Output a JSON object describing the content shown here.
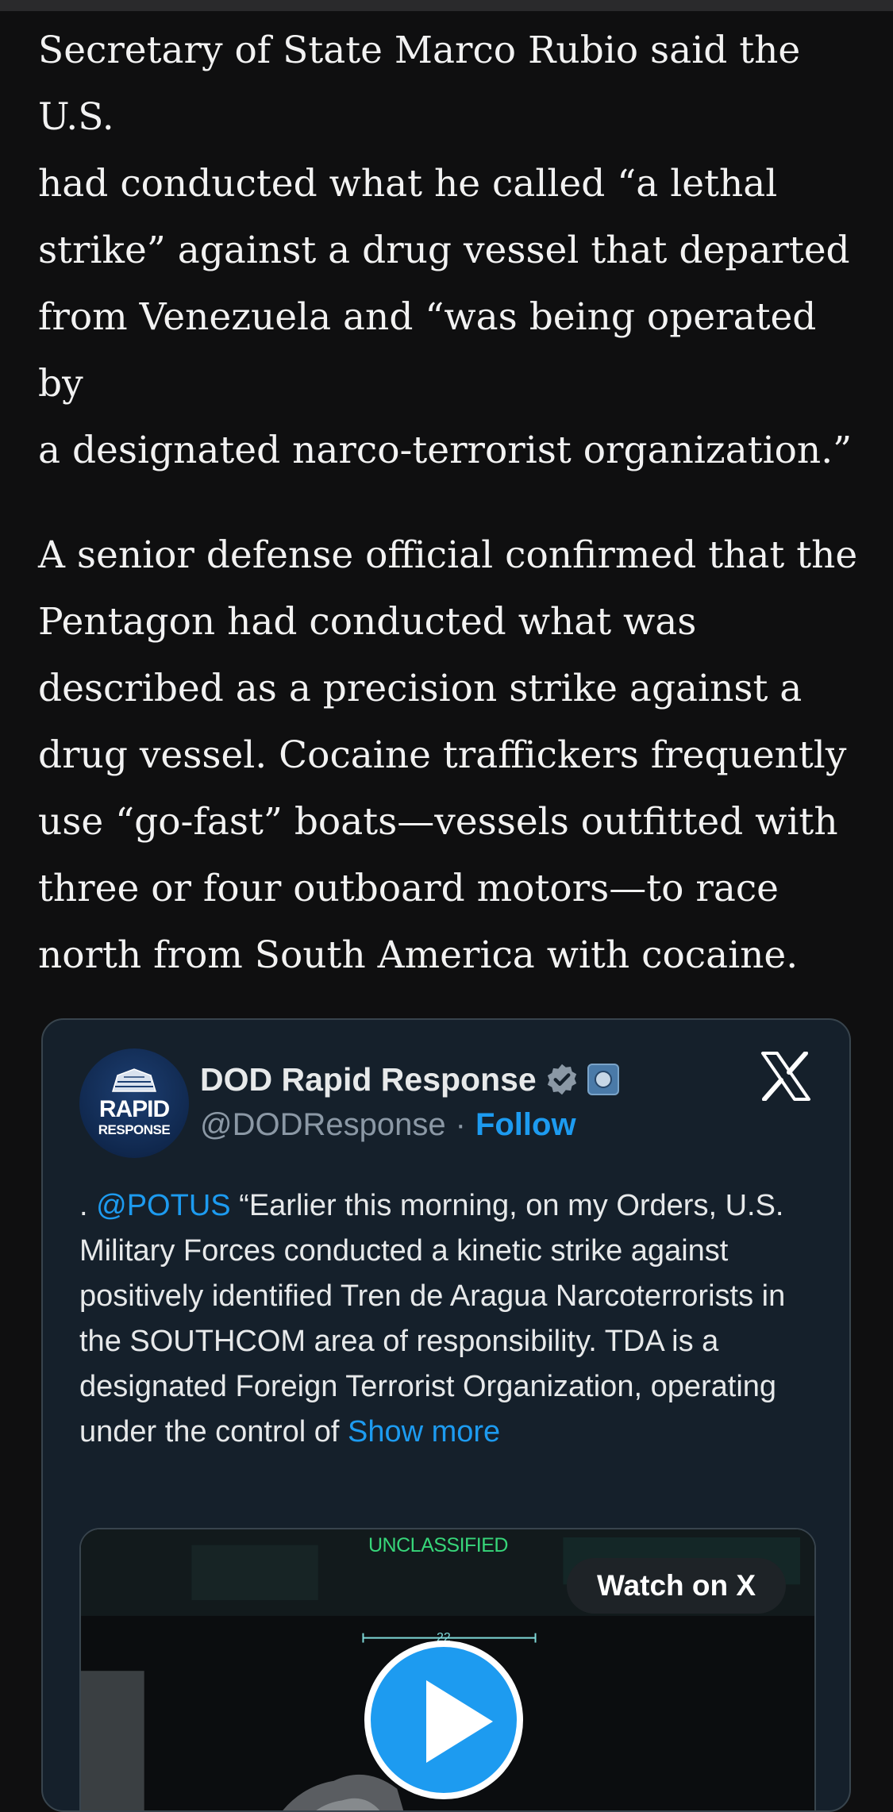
{
  "article": {
    "paragraph_1": "Secretary of State Marco Rubio said the U.S.\nhad conducted what he called “a lethal\nstrike” against a drug vessel that departed\nfrom Venezuela and “was being operated by\na designated narco-terrorist organization.”",
    "paragraph_2": "A senior defense official confirmed that the\nPentagon had conducted what was\ndescribed as a precision strike against a\ndrug vessel. Cocaine traffickers frequently\nuse “go-fast” boats—vessels outfitted with\nthree or four outboard motors—to race\nnorth from South America with cocaine."
  },
  "tweet": {
    "avatar": {
      "line_1": "RAPID",
      "line_2": "RESPONSE"
    },
    "display_name": "DOD Rapid Response",
    "handle": "@DODResponse",
    "separator": "·",
    "follow_label": "Follow",
    "text_prefix": ". ",
    "mention": "@POTUS",
    "text_body": " “Earlier this morning, on my Orders, U.S. Military Forces conducted a kinetic strike against positively identified Tren de Aragua Narcoterrorists in the SOUTHCOM area of responsibility. TDA is a designated Foreign Terrorist Organization, operating under the control of ",
    "show_more_label": "Show more",
    "media": {
      "overlay_label": "UNCLASSIFIED",
      "reticle_number": "22",
      "watch_label": "Watch on X"
    }
  },
  "colors": {
    "page_background": "#0f0f10",
    "card_background": "#15202b",
    "link_blue": "#1d9bf0",
    "muted_text": "#8b98a5",
    "unclassified_green": "#37d67a"
  },
  "icons": [
    "verified-badge-icon",
    "affiliate-badge-icon",
    "x-logo-icon",
    "play-icon"
  ]
}
